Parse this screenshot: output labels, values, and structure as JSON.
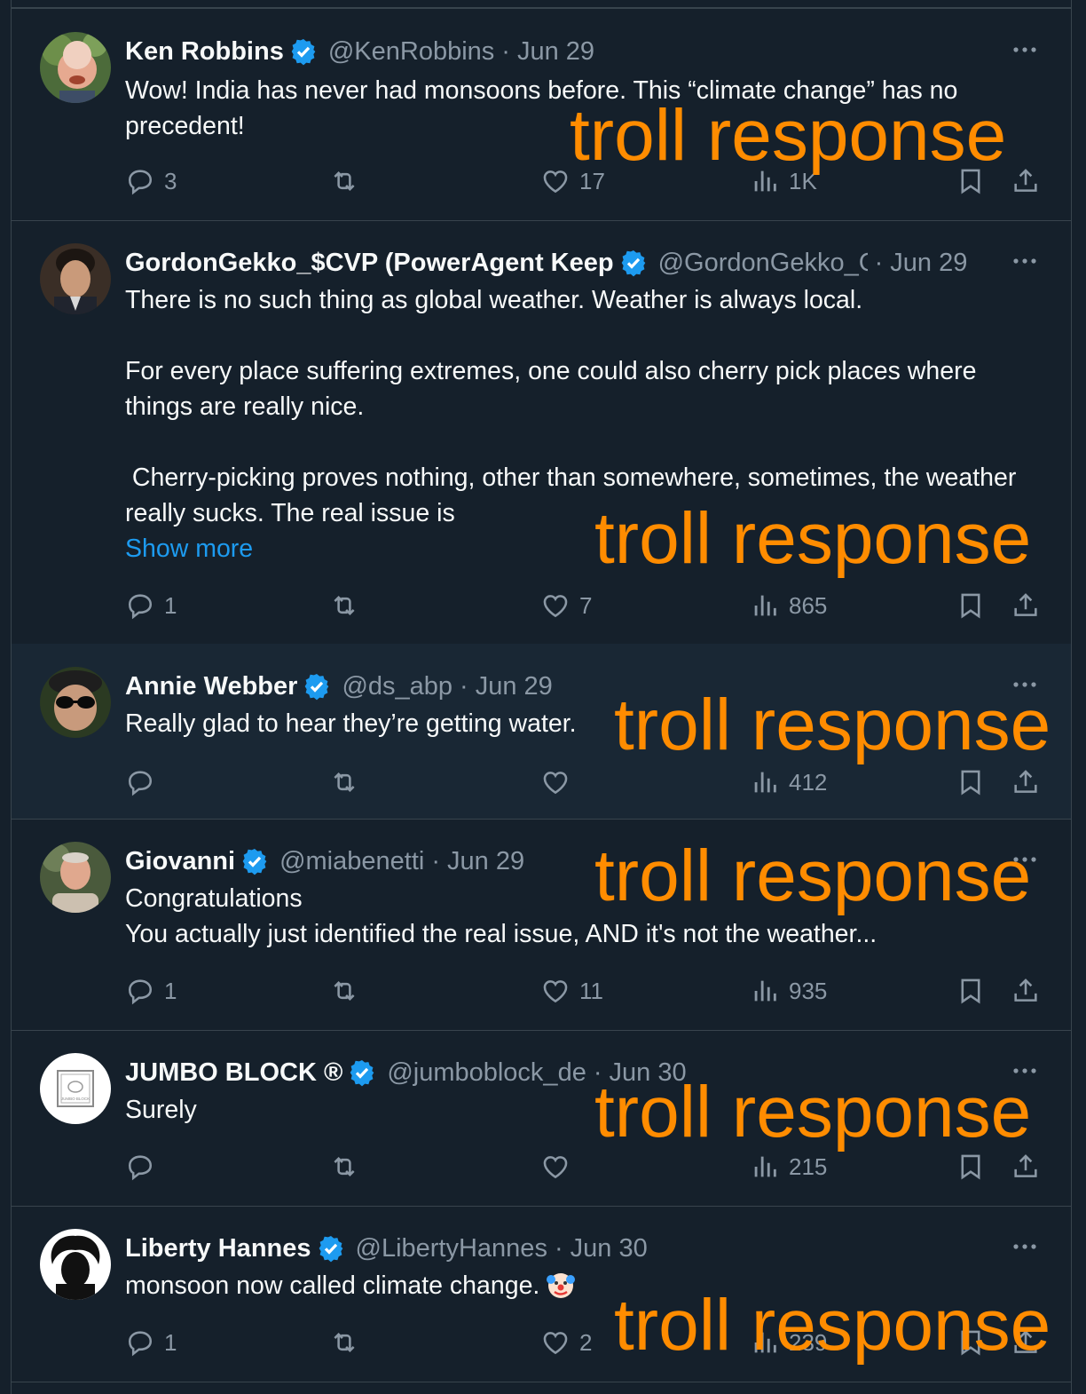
{
  "overlay_label": "troll response",
  "colors": {
    "background": "#15202b",
    "text": "#f7f9f9",
    "muted": "#8b98a5",
    "link": "#1d9bf0",
    "verified": "#1d9bf0",
    "overlay": "#ff8c00"
  },
  "tweets": [
    {
      "name": "Ken Robbins",
      "handle": "@KenRobbins",
      "date": "Jun 29",
      "text": [
        "Wow! India has never had monsoons before. This “climate change” has no precedent!"
      ],
      "show_more": "",
      "counts": {
        "replies": "3",
        "retweets": "",
        "likes": "17",
        "views": "1K"
      }
    },
    {
      "name": "GordonGekko_$CVP (PowerAgent Keep",
      "handle": "@GordonGekko_C\\",
      "date": "Jun 29",
      "text": [
        "There is no such thing as global weather. Weather is always local.",
        "For every place suffering extremes, one could also cherry pick places where things are really nice.",
        " Cherry-picking proves nothing, other than somewhere, sometimes, the weather really sucks. The real issue is"
      ],
      "show_more": "Show more",
      "counts": {
        "replies": "1",
        "retweets": "",
        "likes": "7",
        "views": "865"
      }
    },
    {
      "name": "Annie Webber",
      "handle": "@ds_abp",
      "date": "Jun 29",
      "text": [
        "Really glad to hear they’re getting water."
      ],
      "show_more": "",
      "counts": {
        "replies": "",
        "retweets": "",
        "likes": "",
        "views": "412"
      }
    },
    {
      "name": "Giovanni",
      "handle": "@miabenetti",
      "date": "Jun 29",
      "text": [
        "Congratulations",
        "You actually just identified the real issue, AND it's not the weather..."
      ],
      "show_more": "",
      "counts": {
        "replies": "1",
        "retweets": "",
        "likes": "11",
        "views": "935"
      }
    },
    {
      "name": "JUMBO BLOCK ®",
      "handle": "@jumboblock_de",
      "date": "Jun 30",
      "text": [
        "Surely"
      ],
      "show_more": "",
      "avatar_text": "JUMBO BLOCK",
      "counts": {
        "replies": "",
        "retweets": "",
        "likes": "",
        "views": "215"
      }
    },
    {
      "name": "Liberty Hannes",
      "handle": "@LibertyHannes",
      "date": "Jun 30",
      "text": [
        "monsoon now called climate change."
      ],
      "show_more": "",
      "emoji": "clown-face-icon",
      "counts": {
        "replies": "1",
        "retweets": "",
        "likes": "2",
        "views": "239"
      }
    }
  ]
}
